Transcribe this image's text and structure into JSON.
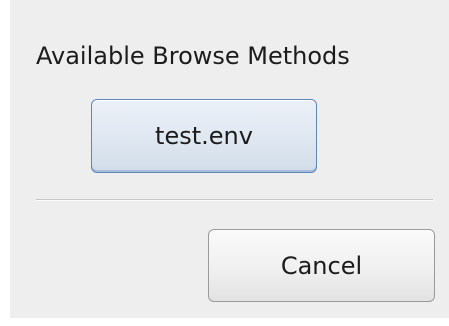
{
  "dialog": {
    "heading": "Available Browse Methods",
    "methods": [
      {
        "label": "test.env"
      }
    ],
    "cancel_label": "Cancel"
  }
}
